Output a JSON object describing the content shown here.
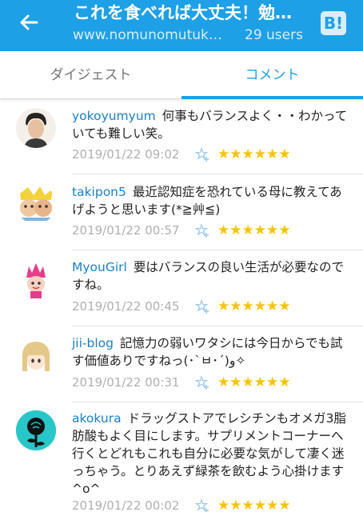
{
  "header": {
    "title": "これを食べれば大丈夫！勉…",
    "url": "www.nomunomutuk…",
    "users": "29 users",
    "b_icon_text": "B!"
  },
  "tabs": [
    {
      "label": "ダイジェスト",
      "active": false
    },
    {
      "label": "コメント",
      "active": true
    }
  ],
  "comments": [
    {
      "user": "yokoyumyum",
      "text": "何事もバランスよく・・わかっていても難しい笑。",
      "date": "2019/01/22 09:02",
      "stars": "★★★★★★",
      "avatar_icon": "person-avatar-icon"
    },
    {
      "user": "takipon5",
      "text": "最近認知症を恐れている母に教えてあげようと思います(*≧艸≦)",
      "date": "2019/01/22 00:57",
      "stars": "★★★★★★",
      "avatar_icon": "cartoon-faces-avatar-icon"
    },
    {
      "user": "MyouGirl",
      "text": "要はバランスの良い生活が必要なのですね。",
      "date": "2019/01/22 00:45",
      "stars": "★★★★★★",
      "avatar_icon": "pink-character-avatar-icon"
    },
    {
      "user": "jii-blog",
      "text": "記憶力の弱いワタシには今日からでも試す価値ありですねっ(･`ㅂ･´)و✧",
      "date": "2019/01/22 00:31",
      "stars": "★★★★★★",
      "avatar_icon": "anime-girl-avatar-icon"
    },
    {
      "user": "akokura",
      "text": "ドラッグストアでレシチンもオメガ3脂肪酸もよく目にします。サプリメントコーナーへ行くとどれもこれも自分に必要な気がして凄く迷っちゃう。とりあえず緑茶を飲むよう心掛けます^o^",
      "date": "2019/01/22 00:02",
      "stars": "★★★★★★",
      "avatar_icon": "rose-avatar-icon"
    }
  ],
  "colors": {
    "accent": "#1ea0e6",
    "star": "#f5c400",
    "username": "#1a7fc4"
  }
}
